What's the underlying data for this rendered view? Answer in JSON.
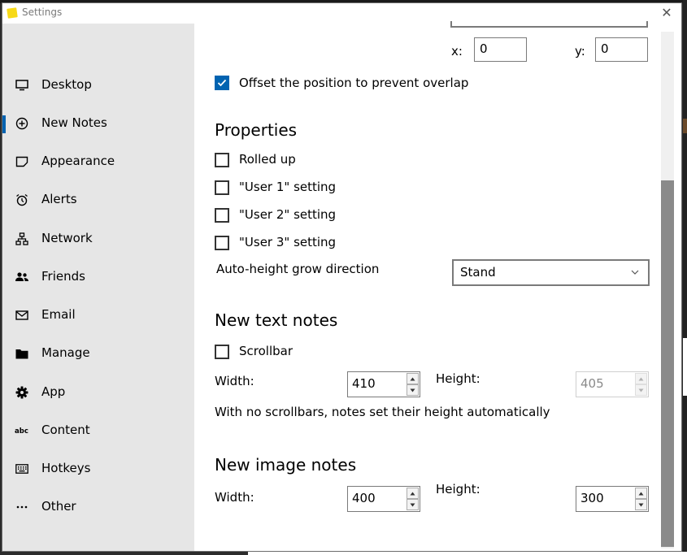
{
  "window": {
    "title": "Settings",
    "close_glyph": "✕"
  },
  "sidebar": {
    "items": [
      {
        "label": "Desktop",
        "icon": "monitor-icon",
        "selected": false
      },
      {
        "label": "New Notes",
        "icon": "plus-circle-icon",
        "selected": true
      },
      {
        "label": "Appearance",
        "icon": "note-icon",
        "selected": false
      },
      {
        "label": "Alerts",
        "icon": "alarm-clock-icon",
        "selected": false
      },
      {
        "label": "Network",
        "icon": "network-icon",
        "selected": false
      },
      {
        "label": "Friends",
        "icon": "people-icon",
        "selected": false
      },
      {
        "label": "Email",
        "icon": "mail-icon",
        "selected": false
      },
      {
        "label": "Manage",
        "icon": "folder-icon",
        "selected": false
      },
      {
        "label": "App",
        "icon": "gear-icon",
        "selected": false
      },
      {
        "label": "Content",
        "icon": "abc-icon",
        "selected": false
      },
      {
        "label": "Hotkeys",
        "icon": "keyboard-icon",
        "selected": false
      },
      {
        "label": "Other",
        "icon": "more-icon",
        "selected": false
      }
    ],
    "accent": "#0063b1"
  },
  "position": {
    "x_label": "x:",
    "x_value": "0",
    "y_label": "y:",
    "y_value": "0",
    "offset_label": "Offset the position to prevent overlap",
    "offset_checked": true
  },
  "properties": {
    "heading": "Properties",
    "rolled_up": "Rolled up",
    "user1": "\"User 1\" setting",
    "user2": "\"User 2\" setting",
    "user3": "\"User 3\" setting",
    "grow_label": "Auto-height grow direction",
    "grow_value": "Stand"
  },
  "text_notes": {
    "heading": "New text notes",
    "scrollbar_label": "Scrollbar",
    "width_label": "Width:",
    "width_value": "410",
    "height_label": "Height:",
    "height_value": "405",
    "hint": "With no scrollbars, notes set their height automatically"
  },
  "image_notes": {
    "heading": "New image notes",
    "width_label": "Width:",
    "width_value": "400",
    "height_label": "Height:",
    "height_value": "300"
  }
}
